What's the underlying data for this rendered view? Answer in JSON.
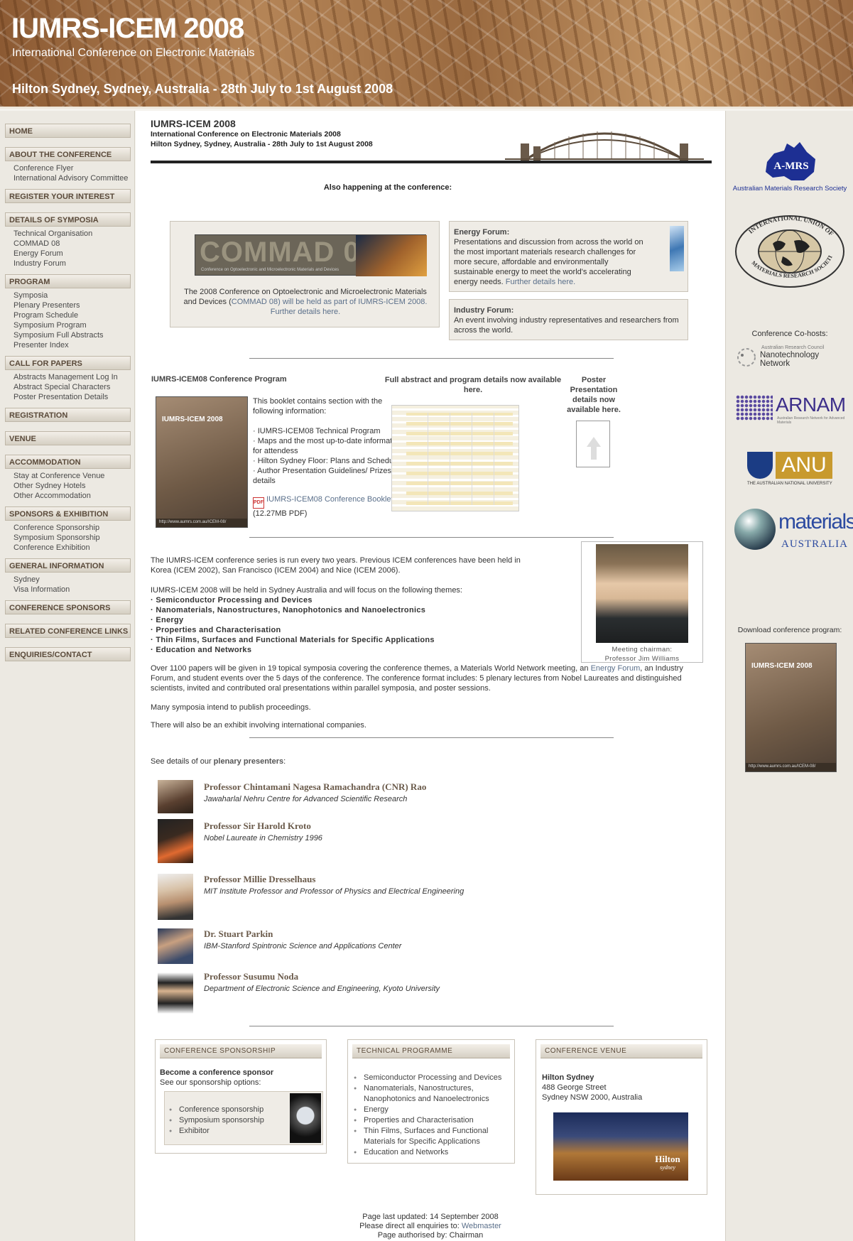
{
  "banner": {
    "title": "IUMRS-ICEM 2008",
    "subtitle": "International Conference on Electronic Materials",
    "venue": "Hilton Sydney, Sydney, Australia - 28th July to 1st August 2008"
  },
  "nav": {
    "home": "HOME",
    "about": "ABOUT THE CONFERENCE",
    "about_items": [
      "Conference Flyer",
      "International Advisory Committee"
    ],
    "register": "REGISTER YOUR INTEREST",
    "symposia": "DETAILS OF SYMPOSIA",
    "symposia_items": [
      "Technical Organisation",
      "COMMAD 08",
      "Energy Forum",
      "Industry Forum"
    ],
    "program": "PROGRAM",
    "program_items": [
      "Symposia",
      "Plenary Presenters",
      "Program Schedule",
      "Symposium Program",
      "Symposium Full Abstracts",
      "Presenter Index"
    ],
    "call": "CALL FOR PAPERS",
    "call_items": [
      "Abstracts Management Log In",
      "Abstract Special Characters",
      "Poster Presentation Details"
    ],
    "registration": "REGISTRATION",
    "venue": "VENUE",
    "accommodation": "ACCOMMODATION",
    "accommodation_items": [
      "Stay at Conference Venue",
      "Other Sydney Hotels",
      "Other Accommodation"
    ],
    "sponsors": "SPONSORS & EXHIBITION",
    "sponsors_items": [
      "Conference Sponsorship",
      "Symposium Sponsorship",
      "Conference Exhibition"
    ],
    "general": "GENERAL INFORMATION",
    "general_items": [
      "Sydney",
      "Visa Information"
    ],
    "conf_sponsors": "CONFERENCE SPONSORS",
    "related": "RELATED CONFERENCE LINKS",
    "enquiries": "ENQUIRIES/CONTACT"
  },
  "header": {
    "title": "IUMRS-ICEM 2008",
    "line1": "International Conference on Electronic Materials 2008",
    "line2": "Hilton Sydney, Sydney, Australia - 28th July to 1st August 2008"
  },
  "also": {
    "heading": "Also happening at the conference:",
    "commad_logo": "COMMAD 08",
    "commad_logo_sub": "Conference on Optoelectronic and Microelectronic Materials and Devices",
    "commad_text_a": "The 2008 Conference on Optoelectronic and Microelectronic Materials and Devices (",
    "commad_link": "COMMAD 08",
    "commad_text_b": ") will be held as part of IUMRS-ICEM 2008. Further details here.",
    "energy_title": "Energy Forum:",
    "energy_text": "Presentations and discussion from across the world on the most important materials research challenges for more secure, affordable and environmentally sustainable energy to meet the world's accelerating energy needs. ",
    "energy_link": "Further details here.",
    "industry_title": "Industry Forum:",
    "industry_text": "An event involving industry representatives and researchers from across the world."
  },
  "program_section": {
    "title": "IUMRS-ICEM08 Conference Program",
    "booklet_intro": "This booklet contains section with the following information:",
    "booklet_items": [
      "· IUMRS-ICEM08 Technical Program",
      "· Maps and the most up-to-date information for attendess",
      "· Hilton Sydney Floor: Plans and Schedules",
      "· Author Presentation Guidelines/ Prizes details"
    ],
    "booklet_link": "IUMRS-ICEM08 Conference Booklet",
    "booklet_size": "(12.27MB PDF)",
    "abstract_heading": "Full abstract and program details now available here.",
    "poster_heading": "Poster Presentation details now available here.",
    "cover_title": "IUMRS-ICEM 2008",
    "cover_url": "http://www.aumrs.com.au/ICEM-08/"
  },
  "about": {
    "p1": "The IUMRS-ICEM conference series is run every two years. Previous ICEM conferences have been held in Korea (ICEM 2002), San Francisco (ICEM 2004) and Nice (ICEM 2006).",
    "p2": "IUMRS-ICEM 2008 will be held in Sydney Australia and will focus on the following themes:",
    "themes": [
      "· Semiconductor Processing and Devices",
      "· Nanomaterials, Nanostructures, Nanophotonics and Nanoelectronics",
      "· Energy",
      "· Properties and Characterisation",
      "· Thin Films, Surfaces and Functional Materials for Specific Applications",
      "· Education and Networks"
    ],
    "p3a": "Over 1100 papers will be given in 19 topical symposia covering the conference themes, a Materials World Network meeting, an ",
    "p3_link": "Energy Forum",
    "p3b": ", an Industry Forum, and student events over the 5 days of the conference. The conference format includes: 5 plenary lectures from Nobel Laureates and distinguished scientists, invited and contributed oral presentations within parallel symposia, and poster sessions.",
    "p4": "Many symposia intend to publish proceedings.",
    "p5": "There will also be an exhibit involving international companies.",
    "chairman_caption1": "Meeting chairman:",
    "chairman_caption2": "Professor Jim Williams"
  },
  "plenary": {
    "intro_a": "See details of our ",
    "intro_b": "plenary presenters",
    "intro_c": ":",
    "presenters": [
      {
        "name": "Professor Chintamani Nagesa Ramachandra (CNR) Rao",
        "aff": "Jawaharlal Nehru Centre for Advanced Scientific Research"
      },
      {
        "name": "Professor Sir Harold Kroto",
        "aff": "Nobel Laureate in Chemistry 1996"
      },
      {
        "name": "Professor Millie Dresselhaus",
        "aff": "MIT Institute Professor and Professor of Physics and Electrical Engineering"
      },
      {
        "name": "Dr. Stuart Parkin",
        "aff": "IBM-Stanford Spintronic Science and Applications Center"
      },
      {
        "name": "Professor Susumu Noda",
        "aff": "Department of Electronic Science and Engineering, Kyoto University"
      }
    ]
  },
  "panels": {
    "sponsorship": {
      "head": "CONFERENCE SPONSORSHIP",
      "title": "Become a conference sponsor",
      "sub": "See our sponsorship options:",
      "items": [
        "Conference sponsorship",
        "Symposium sponsorship",
        "Exhibitor"
      ]
    },
    "technical": {
      "head": "TECHNICAL PROGRAMME",
      "items": [
        "Semiconductor Processing and Devices",
        "Nanomaterials, Nanostructures, Nanophotonics and Nanoelectronics",
        "Energy",
        "Properties and Characterisation",
        "Thin Films, Surfaces and Functional Materials for Specific Applications",
        "Education and Networks"
      ]
    },
    "venue": {
      "head": "CONFERENCE VENUE",
      "name": "Hilton Sydney",
      "addr1": "488 George Street",
      "addr2": "Sydney NSW 2000, Australia",
      "hilton_logo": "Hilton",
      "hilton_logo_sub": "sydney"
    }
  },
  "footer": {
    "updated": "Page last updated: 14 September 2008",
    "enquiries_a": "Please direct all enquiries to: ",
    "enquiries_link": "Webmaster",
    "authorised": "Page authorised by: Chairman"
  },
  "sidebar": {
    "amrs_label": "A-MRS",
    "amrs_caption": "Australian Materials Research Society",
    "iumrs_top": "INTERNATIONAL UNION OF",
    "iumrs_bottom": "MATERIALS RESEARCH SOCIETIES",
    "cohosts": "Conference Co-hosts:",
    "nano_small": "Australian Research Council",
    "nano": "Nanotechnology Network",
    "arnam": "ARNAM",
    "arnam_small": "Australian Research Network for Advanced Materials",
    "anu": "ANU",
    "anu_caption": "THE AUSTRALIAN NATIONAL UNIVERSITY",
    "materials": "materials",
    "materials_sub": "AUSTRALIA",
    "download": "Download conference program:",
    "cover_title": "IUMRS-ICEM 2008",
    "cover_url": "http://www.aumrs.com.au/ICEM-08/"
  },
  "colors": {
    "accent": "#5a6f8a",
    "nav_text": "#5a4a3a",
    "banner": "#a87a4e"
  }
}
